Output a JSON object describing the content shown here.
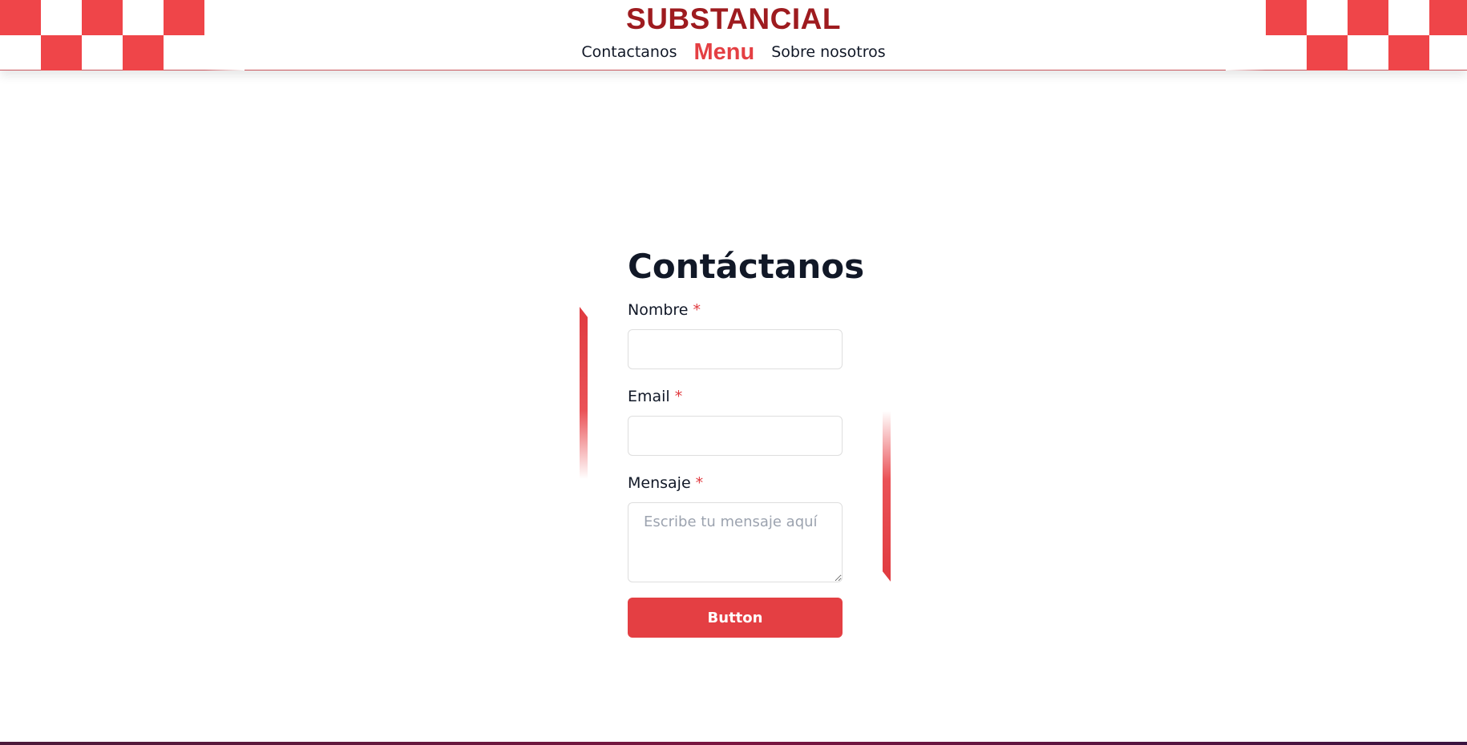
{
  "header": {
    "brand": "SUBSTANCIAL",
    "nav": [
      {
        "label": "Contactanos"
      },
      {
        "label": "Menu"
      },
      {
        "label": "Sobre nosotros"
      }
    ]
  },
  "form": {
    "title": "Contáctanos",
    "fields": [
      {
        "label": "Nombre",
        "required_mark": "*",
        "value": "",
        "placeholder": ""
      },
      {
        "label": "Email",
        "required_mark": "*",
        "value": "",
        "placeholder": ""
      },
      {
        "label": "Mensaje",
        "required_mark": "*",
        "value": "",
        "placeholder": "Escribe tu mensaje aquí"
      }
    ],
    "submit_label": "Button"
  },
  "colors": {
    "accent": "#e43f43",
    "brand": "#9e1b1f",
    "checker": "#ef4549"
  }
}
